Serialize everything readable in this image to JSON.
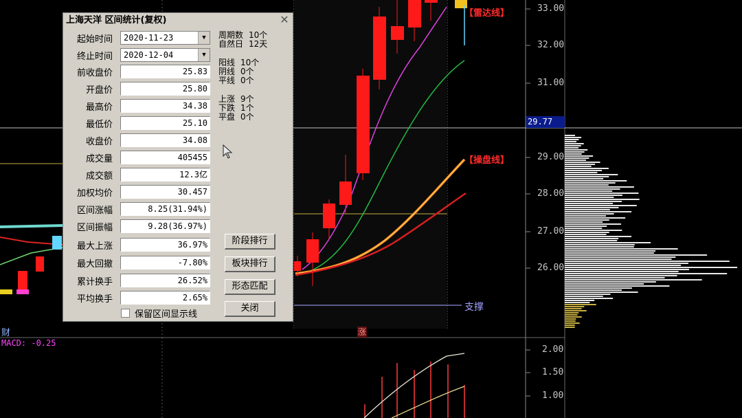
{
  "dialog": {
    "title": "上海天洋 区间统计(复权)",
    "start_label": "起始时间",
    "start_value": "2020-11-23",
    "end_label": "终止时间",
    "end_value": "2020-12-04",
    "rows": [
      {
        "label": "前收盘价",
        "value": "25.83"
      },
      {
        "label": "开盘价",
        "value": "25.80"
      },
      {
        "label": "最高价",
        "value": "34.38"
      },
      {
        "label": "最低价",
        "value": "25.10"
      },
      {
        "label": "收盘价",
        "value": "34.08"
      },
      {
        "label": "成交量",
        "value": "405455"
      },
      {
        "label": "成交额",
        "value": "12.3亿"
      },
      {
        "label": "加权均价",
        "value": "30.457"
      },
      {
        "label": "区间涨幅",
        "value": "8.25(31.94%)"
      },
      {
        "label": "区间振幅",
        "value": "9.28(36.97%)"
      },
      {
        "label": "最大上涨",
        "value": "36.97%"
      },
      {
        "label": "最大回撤",
        "value": "-7.80%"
      },
      {
        "label": "累计换手",
        "value": "26.52%"
      },
      {
        "label": "平均换手",
        "value": "2.65%"
      }
    ],
    "stats": [
      {
        "label": "周期数",
        "value": "10个"
      },
      {
        "label": "自然日",
        "value": "12天"
      },
      {
        "label": "阳线",
        "value": "10个"
      },
      {
        "label": "阴线",
        "value": "0个"
      },
      {
        "label": "平线",
        "value": "0个"
      },
      {
        "label": "上涨",
        "value": "9个"
      },
      {
        "label": "下跌",
        "value": "1个"
      },
      {
        "label": "平盘",
        "value": "0个"
      }
    ],
    "buttons": {
      "stage_rank": "阶段排行",
      "sector_rank": "板块排行",
      "pattern_match": "形态匹配",
      "close": "关闭"
    },
    "keep_interval_label": "保留区间显示线",
    "close_glyph": "✕"
  },
  "chart": {
    "price_ticks": [
      "33.00",
      "32.00",
      "31.00",
      "29.00",
      "28.00",
      "27.00",
      "26.00"
    ],
    "current_price": "29.77",
    "radar_line_label": "【雷达线】",
    "operate_line_label": "【操盘线】",
    "support_label": "支撑",
    "macd_label": "MACD: -0.25",
    "macd_ticks": [
      "2.00",
      "1.50",
      "1.00"
    ],
    "cai_label": "财",
    "zhang_label": "涨",
    "colors": {
      "up_candle": "#ff1a1a",
      "ma_magenta": "#e040e0",
      "ma_green": "#22bb44",
      "operate_line": "#ff8c1a",
      "volume_profile": "#e8e8e8",
      "volume_profile_low": "#c8b040"
    }
  }
}
